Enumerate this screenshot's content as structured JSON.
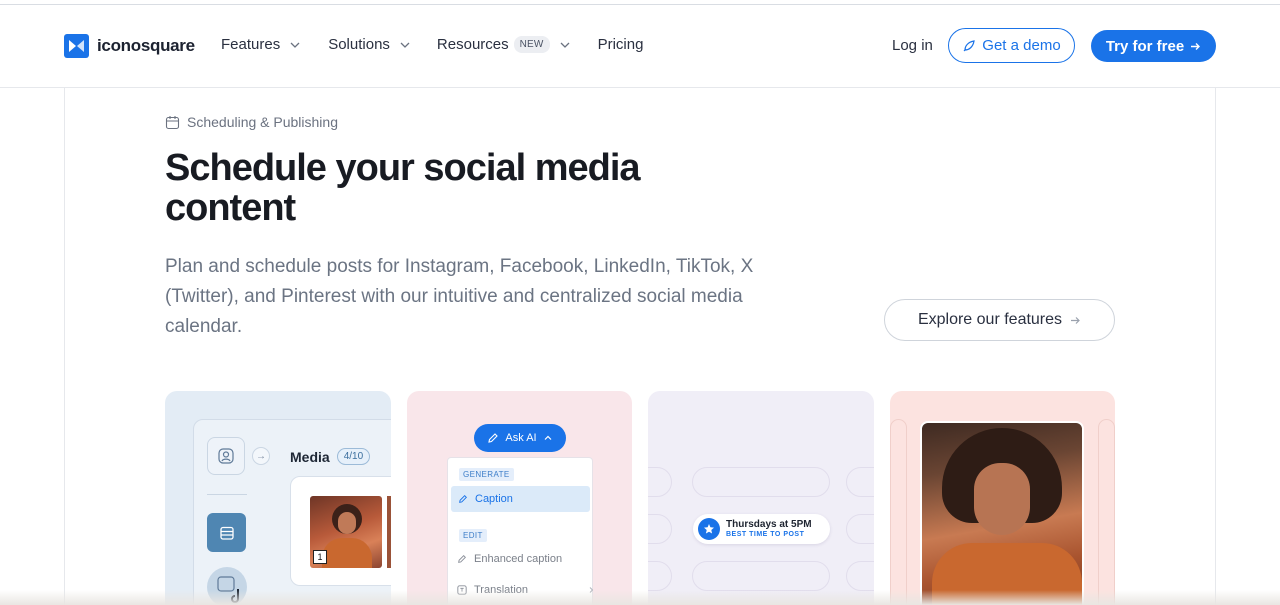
{
  "brand": {
    "name": "iconosquare",
    "accent": "#1a73e8"
  },
  "nav": {
    "features": "Features",
    "solutions": "Solutions",
    "resources": "Resources",
    "resources_badge": "NEW",
    "pricing": "Pricing"
  },
  "header_actions": {
    "login": "Log in",
    "demo": "Get a demo",
    "try": "Try for free"
  },
  "hero": {
    "eyebrow": "Scheduling & Publishing",
    "title": "Schedule your social media content",
    "description": "Plan and schedule posts for Instagram, Facebook, LinkedIn, TikTok, X (Twitter), and Pinterest with our intuitive and centralized social media calendar.",
    "explore": "Explore our features"
  },
  "cards": {
    "media": {
      "title": "Media",
      "count": "4/10",
      "thumb_index": "1"
    },
    "ai": {
      "button": "Ask AI",
      "generate_label": "GENERATE",
      "caption": "Caption",
      "edit_label": "EDIT",
      "enhanced": "Enhanced caption",
      "translation": "Translation"
    },
    "timing": {
      "time": "Thursdays at 5PM",
      "label": "BEST TIME TO POST"
    }
  },
  "icons": [
    "logo-icon",
    "chevron-down-icon",
    "rocket-icon",
    "arrow-right-icon",
    "calendar-icon",
    "pencil-icon",
    "star-icon",
    "tiktok-icon"
  ]
}
